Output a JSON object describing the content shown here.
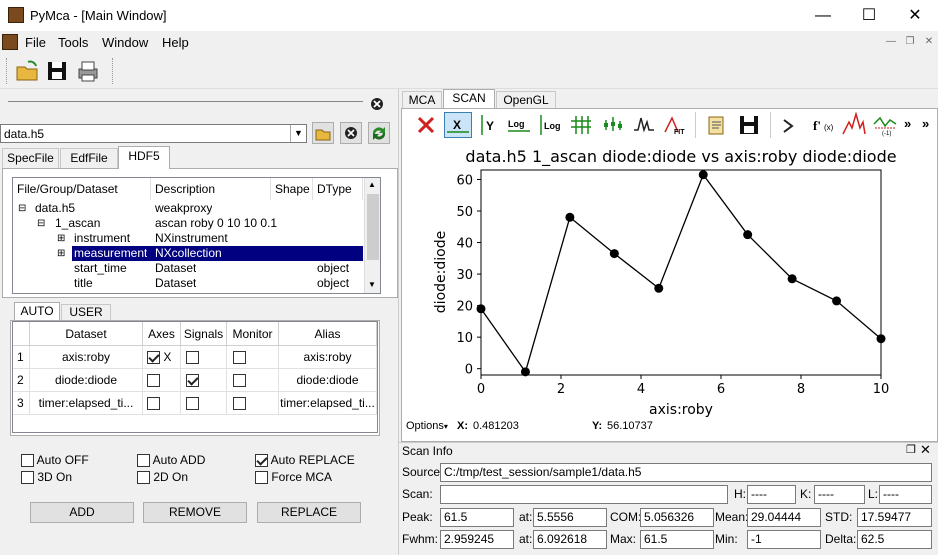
{
  "window": {
    "title": "PyMca - [Main Window]"
  },
  "menu": [
    "File",
    "Tools",
    "Window",
    "Help"
  ],
  "left": {
    "file_combo": "data.h5",
    "source_tabs": [
      "SpecFile",
      "EdfFile",
      "HDF5"
    ],
    "tree_headers": [
      "File/Group/Dataset",
      "Description",
      "Shape",
      "DType"
    ],
    "tree_rows": [
      {
        "name": "data.h5",
        "desc": "weakproxy",
        "shape": "",
        "dtype": ""
      },
      {
        "name": "1_ascan",
        "desc": "ascan roby 0 10 10 0.1",
        "shape": "",
        "dtype": ""
      },
      {
        "name": "instrument",
        "desc": "NXinstrument",
        "shape": "",
        "dtype": ""
      },
      {
        "name": "measurement",
        "desc": "NXcollection",
        "shape": "",
        "dtype": ""
      },
      {
        "name": "start_time",
        "desc": "Dataset",
        "shape": "",
        "dtype": "object"
      },
      {
        "name": "title",
        "desc": "Dataset",
        "shape": "",
        "dtype": "object"
      }
    ],
    "sel_tabs": [
      "AUTO",
      "USER"
    ],
    "grid_headers": [
      "Dataset",
      "Axes",
      "Signals",
      "Monitor",
      "Alias"
    ],
    "grid_rows": [
      {
        "n": "1",
        "dataset": "axis:roby",
        "axes": true,
        "axes_label": "X",
        "signals": false,
        "monitor": false,
        "alias": "axis:roby"
      },
      {
        "n": "2",
        "dataset": "diode:diode",
        "axes": false,
        "axes_label": "",
        "signals": true,
        "monitor": false,
        "alias": "diode:diode"
      },
      {
        "n": "3",
        "dataset": "timer:elapsed_ti...",
        "axes": false,
        "axes_label": "",
        "signals": false,
        "monitor": false,
        "alias": "timer:elapsed_ti..."
      }
    ],
    "options": {
      "auto_off": "Auto OFF",
      "auto_add": "Auto ADD",
      "auto_replace": "Auto REPLACE",
      "three_d": "3D On",
      "two_d": "2D On",
      "force_mca": "Force MCA"
    },
    "buttons": {
      "add": "ADD",
      "remove": "REMOVE",
      "replace": "REPLACE"
    }
  },
  "right": {
    "tabs": [
      "MCA",
      "SCAN",
      "OpenGL"
    ],
    "options_label": "Options",
    "cursor": {
      "x_label": "X:",
      "x": "0.481203",
      "y_label": "Y:",
      "y": "56.10737"
    },
    "scan_info": {
      "title": "Scan Info",
      "source_label": "Source:",
      "source": "C:/tmp/test_session/sample1/data.h5",
      "scan_label": "Scan:",
      "h_label": "H:",
      "h": "----",
      "k_label": "K:",
      "k": "----",
      "l_label": "L:",
      "l": "----",
      "peak_label": "Peak:",
      "peak": "61.5",
      "at1_label": "at:",
      "at1": "5.5556",
      "com_label": "COM:",
      "com": "5.056326",
      "mean_label": "Mean:",
      "mean": "29.04444",
      "std_label": "STD:",
      "std": "17.59477",
      "fwhm_label": "Fwhm:",
      "fwhm": "2.959245",
      "at2_label": "at:",
      "at2": "6.092618",
      "max_label": "Max:",
      "max": "61.5",
      "min_label": "Min:",
      "min": "-1",
      "delta_label": "Delta:",
      "delta": "62.5"
    }
  },
  "chart_data": {
    "type": "line",
    "title": "data.h5 1_ascan diode:diode vs axis:roby diode:diode",
    "xlabel": "axis:roby",
    "ylabel": "diode:diode",
    "xlim": [
      0,
      10
    ],
    "ylim": [
      -2,
      63
    ],
    "xticks": [
      0,
      2,
      4,
      6,
      8,
      10
    ],
    "yticks": [
      0,
      10,
      20,
      30,
      40,
      50,
      60
    ],
    "x": [
      0,
      1.111,
      2.222,
      3.333,
      4.444,
      5.556,
      6.667,
      7.778,
      8.889,
      10
    ],
    "y": [
      19,
      -1,
      48,
      36.5,
      25.5,
      61.5,
      42.5,
      28.5,
      21.5,
      9.5
    ],
    "color": "#000000"
  }
}
